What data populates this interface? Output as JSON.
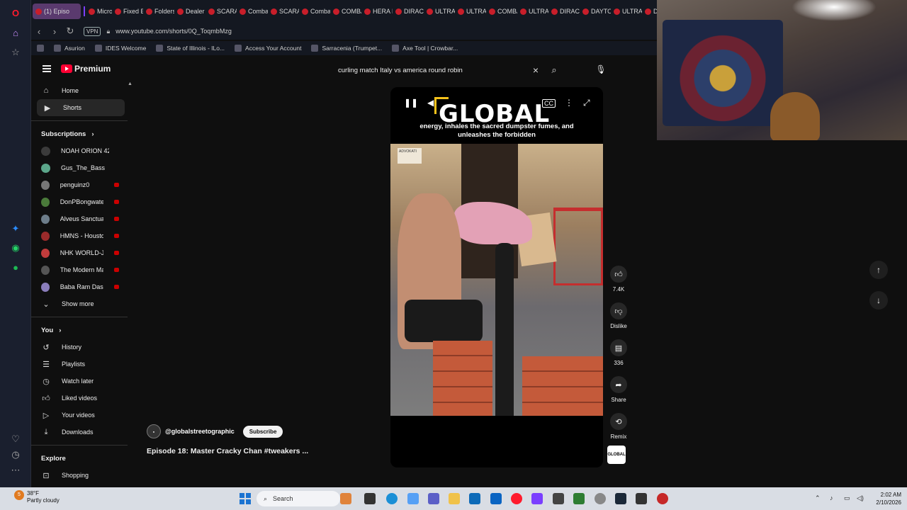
{
  "browser": {
    "tabs": [
      "(1) Episo",
      "Micro",
      "Fixed B",
      "Folders",
      "Dealer",
      "SCARA",
      "Comba",
      "SCARA",
      "Comba",
      "COMBA",
      "HERA D",
      "DIRAC",
      "ULTRA",
      "ULTRA",
      "COMBA",
      "ULTRA",
      "DIRAC",
      "DAYTO",
      "ULTRA",
      "Di"
    ],
    "url": "www.youtube.com/shorts/0Q_ToqmbMzg",
    "vpn_label": "VPN",
    "bookmarks": [
      "Asurion",
      "IDES Welcome",
      "State of Illinois - ILo...",
      "Access Your Account",
      "Sarracenia (Trumpet...",
      "Axe Tool | Crowbar..."
    ]
  },
  "youtube": {
    "logo_text": "Premium",
    "search_value": "curling match Italy vs america round robin",
    "guide": {
      "main": [
        {
          "icon": "home-icon",
          "label": "Home"
        },
        {
          "icon": "shorts-icon",
          "label": "Shorts"
        }
      ],
      "subscriptions_label": "Subscriptions",
      "subscriptions": [
        {
          "label": "NOAH ORION 42",
          "live": false
        },
        {
          "label": "Gus_The_Bass",
          "live": false
        },
        {
          "label": "penguinz0",
          "live": true
        },
        {
          "label": "DonPBongwater",
          "live": true
        },
        {
          "label": "Alveus Sanctuary",
          "live": true
        },
        {
          "label": "HMNS - Houston...",
          "live": true
        },
        {
          "label": "NHK WORLD-JA...",
          "live": true
        },
        {
          "label": "The Modern Mar...",
          "live": true
        },
        {
          "label": "Baba Ram Dass",
          "live": true
        }
      ],
      "show_more": "Show more",
      "you_label": "You",
      "you_items": [
        {
          "icon": "history-icon",
          "label": "History"
        },
        {
          "icon": "playlists-icon",
          "label": "Playlists"
        },
        {
          "icon": "watch-later-icon",
          "label": "Watch later"
        },
        {
          "icon": "liked-videos-icon",
          "label": "Liked videos"
        },
        {
          "icon": "your-videos-icon",
          "label": "Your videos"
        },
        {
          "icon": "downloads-icon",
          "label": "Downloads"
        }
      ],
      "explore_label": "Explore",
      "explore_items": [
        {
          "icon": "shopping-icon",
          "label": "Shopping"
        }
      ]
    },
    "short": {
      "brand_text": "GLOBAL",
      "caption": "energy, inhales the sacred dumpster fumes, and unleashes the forbidden",
      "scene_sign": "ADVOKATI",
      "channel": "@globalstreetographic",
      "subscribe_label": "Subscribe",
      "title": "Episode 18: Master Cracky Chan #tweakers ...",
      "likes": "7.4K",
      "dislike_label": "Dislike",
      "comments": "336",
      "share_label": "Share",
      "remix_label": "Remix",
      "channel_thumb_text": "GLOBAL"
    }
  },
  "taskbar": {
    "weather_temp": "38°F",
    "weather_desc": "Partly cloudy",
    "weather_badge": "5",
    "search_label": "Search",
    "time": "2:02 AM",
    "date": "2/10/2026"
  },
  "colors": {
    "yt_red": "#ff0033",
    "opera_red": "#ff1b2d",
    "background": "#0f0f0f"
  }
}
